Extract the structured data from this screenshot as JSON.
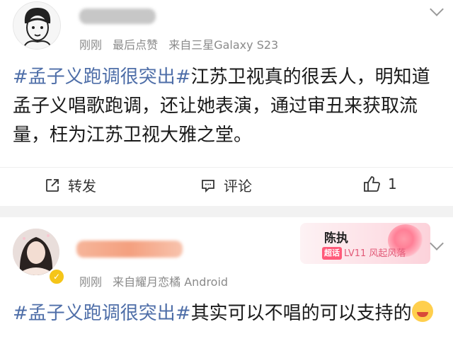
{
  "post1": {
    "meta": {
      "time": "刚刚",
      "action": "最后点赞",
      "source": "来自三星Galaxy S23"
    },
    "text": {
      "topic": "#孟子义跑调很突出#",
      "body": "江苏卫视真的很丢人，明知道孟子义唱歌跑调，还让她表演，通过审丑来获取流量，枉为江苏卫视大雅之堂。"
    },
    "actions": {
      "repost": "转发",
      "comment": "评论",
      "like_count": "1"
    }
  },
  "post2": {
    "badge": {
      "title": "陈执",
      "chip": "超话",
      "level": "LV11 风起风落"
    },
    "meta": {
      "time": "刚刚",
      "source": "来自耀月恋橘 Android"
    },
    "text": {
      "topic": "#孟子义跑调很突出#",
      "body": "其实可以不唱的可以支持的"
    }
  },
  "icons": [
    "share-icon",
    "comment-icon",
    "thumbs-up-icon",
    "chevron-down-icon",
    "verified-badge-icon",
    "emoji-icon"
  ],
  "colors": {
    "topic": "#4e6ea8",
    "meta": "#8a8a8a",
    "separator": "#f2f2f2",
    "badge_accent": "#ff5a7a"
  }
}
